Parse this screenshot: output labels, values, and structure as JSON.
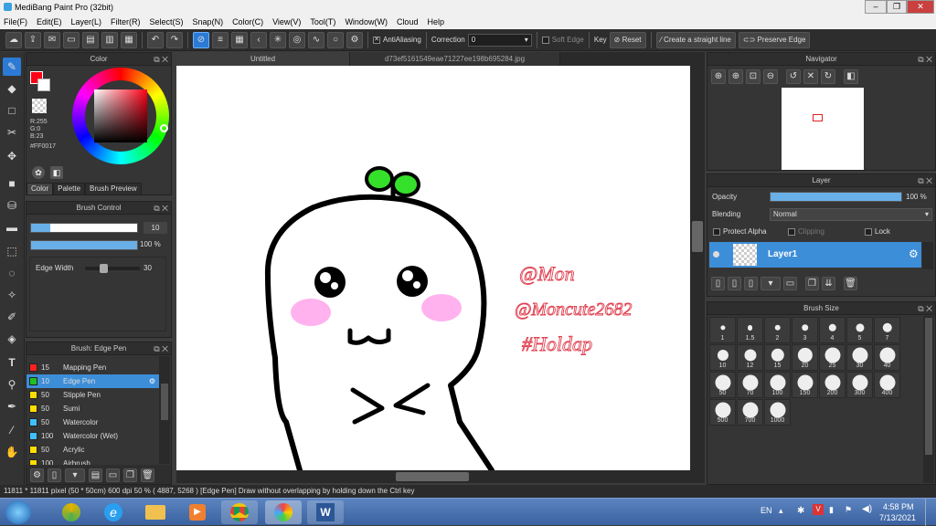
{
  "window": {
    "title": "MediBang Paint Pro (32bit)",
    "minimize": "‒",
    "restore": "❐",
    "close": "✕"
  },
  "menu": [
    "File(F)",
    "Edit(E)",
    "Layer(L)",
    "Filter(R)",
    "Select(S)",
    "Snap(N)",
    "Color(C)",
    "View(V)",
    "Tool(T)",
    "Window(W)",
    "Cloud",
    "Help"
  ],
  "toolbar": {
    "antialiasing": "AntiAliasing",
    "correction_label": "Correction",
    "correction_value": "0",
    "soft_edge": "Soft Edge",
    "key": "Key",
    "reset": "Reset",
    "straight_line": "Create a straight line",
    "preserve_edge": "Preserve Edge"
  },
  "color_panel": {
    "title": "Color",
    "r": "R:255",
    "g": "G:0",
    "b": "B:23",
    "hex": "#FF0017",
    "tabs": [
      "Color",
      "Palette",
      "Brush Preview"
    ],
    "fg_color": "#ff0017"
  },
  "brush_control": {
    "title": "Brush Control",
    "size_value": "10",
    "opacity_value": "100 %",
    "opacity": 1.0,
    "edge_width_label": "Edge Width",
    "edge_width_value": "30"
  },
  "brush_list": {
    "title": "Brush: Edge Pen",
    "items": [
      {
        "size": "15",
        "name": "Mapping Pen",
        "color": "#ff2020"
      },
      {
        "size": "10",
        "name": "Edge Pen",
        "color": "#20c020"
      },
      {
        "size": "50",
        "name": "Stipple Pen",
        "color": "#ffdd00"
      },
      {
        "size": "50",
        "name": "Sumi",
        "color": "#ffdd00"
      },
      {
        "size": "50",
        "name": "Watercolor",
        "color": "#40c0ff"
      },
      {
        "size": "100",
        "name": "Watercolor (Wet)",
        "color": "#40c0ff"
      },
      {
        "size": "50",
        "name": "Acrylic",
        "color": "#ffdd00"
      },
      {
        "size": "100",
        "name": "Airbrush",
        "color": "#ffdd00"
      }
    ]
  },
  "tabs": [
    "Untitled",
    "d73ef5161549eae71227ee198b695284.jpg"
  ],
  "canvas": {
    "handwriting": [
      "@Mon",
      "@Moncute2682",
      "#Holdap"
    ]
  },
  "navigator": {
    "title": "Navigator"
  },
  "layer_panel": {
    "title": "Layer",
    "opacity_label": "Opacity",
    "opacity_value": "100 %",
    "blending_label": "Blending",
    "blending_value": "Normal",
    "protect_alpha": "Protect Alpha",
    "clipping": "Clipping",
    "lock": "Lock",
    "layer_name": "Layer1"
  },
  "brush_size": {
    "title": "Brush Size",
    "sizes": [
      "1",
      "1.5",
      "2",
      "3",
      "4",
      "5",
      "7",
      "10",
      "12",
      "15",
      "20",
      "25",
      "30",
      "40",
      "50",
      "70",
      "100",
      "150",
      "200",
      "300",
      "400",
      "500",
      "700",
      "1000"
    ]
  },
  "status": "11811 * 11811 pixel  (50 * 50cm)  600 dpi  50 %  ( 4887, 5268 )  [Edge Pen] Draw without overlapping by holding down the Ctrl key",
  "taskbar": {
    "lang": "EN",
    "time": "4:58 PM",
    "date": "7/13/2021"
  }
}
